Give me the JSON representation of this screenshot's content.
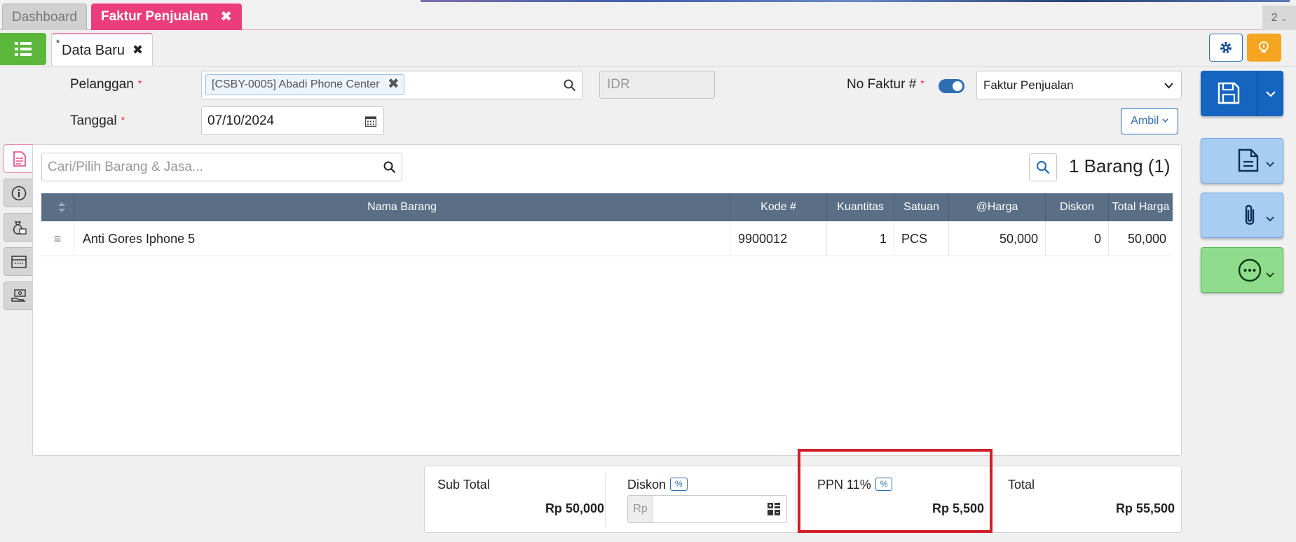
{
  "tabs": {
    "dashboard": "Dashboard",
    "active": "Faktur Penjualan",
    "page_count": "2"
  },
  "doc_tab": {
    "star": "*",
    "label": "Data Baru"
  },
  "form": {
    "pelanggan_label": "Pelanggan",
    "pelanggan_value": "[CSBY-0005] Abadi Phone Center",
    "currency": "IDR",
    "no_faktur_label": "No Faktur #",
    "no_faktur_toggle_on": true,
    "faktur_type": "Faktur Penjualan",
    "tanggal_label": "Tanggal",
    "tanggal_value": "07/10/2024",
    "ambil_label": "Ambil",
    "required_mark": "*"
  },
  "items": {
    "search_placeholder": "Cari/Pilih Barang & Jasa...",
    "count_label": "1 Barang (1)",
    "columns": [
      "Nama Barang",
      "Kode #",
      "Kuantitas",
      "Satuan",
      "@Harga",
      "Diskon",
      "Total Harga"
    ],
    "rows": [
      {
        "nama": "Anti Gores Iphone 5",
        "kode": "9900012",
        "qty": "1",
        "satuan": "PCS",
        "harga": "50,000",
        "diskon": "0",
        "total": "50,000"
      }
    ]
  },
  "totals": {
    "subtotal_label": "Sub Total",
    "subtotal_value": "Rp 50,000",
    "diskon_label": "Diskon",
    "percent_badge": "%",
    "diskon_prefix": "Rp",
    "diskon_value": "",
    "ppn_label": "PPN 11%",
    "ppn_value": "Rp 5,500",
    "total_label": "Total",
    "total_value": "Rp 55,500"
  },
  "colors": {
    "accent_pink": "#ea3d7a",
    "accent_green": "#5cb83c",
    "primary_blue": "#1565c0",
    "table_header": "#5a6e86",
    "highlight_red": "#d21f2b"
  }
}
